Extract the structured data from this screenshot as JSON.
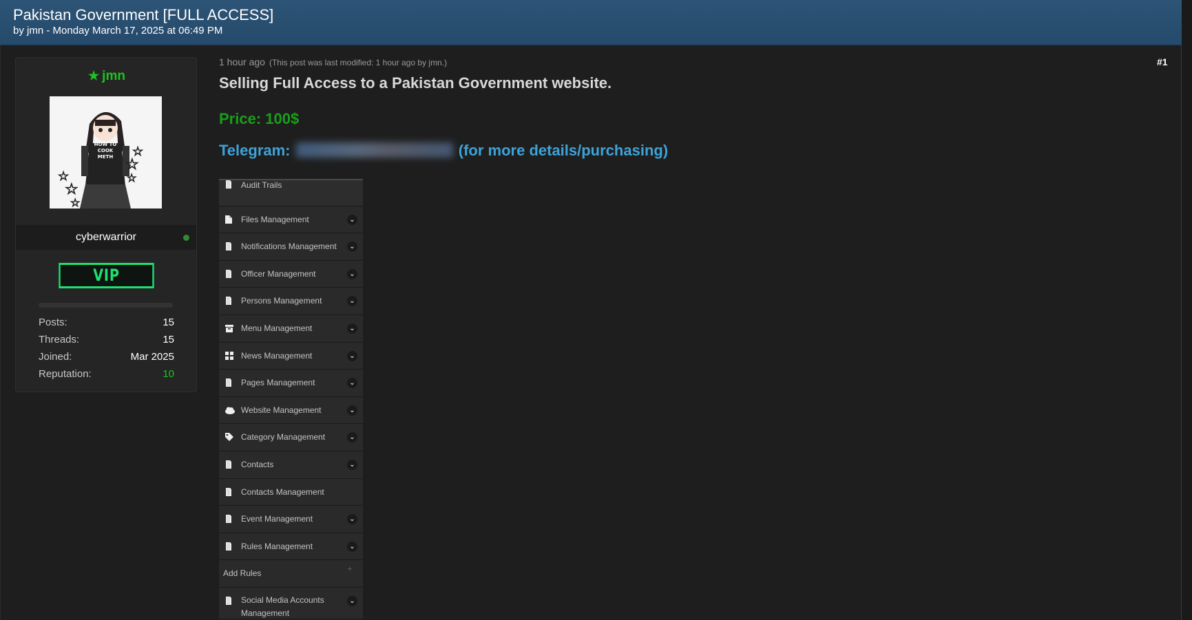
{
  "header": {
    "title": "Pakistan Government [FULL ACCESS]",
    "byline": "by jmn - Monday March 17, 2025 at 06:49 PM"
  },
  "user": {
    "name": "jmn",
    "usertitle": "cyberwarrior",
    "rank_badge": "VIP",
    "avatar_shirt_text": "HOW TO COOK METH",
    "stats": [
      {
        "label": "Posts:",
        "value": "15"
      },
      {
        "label": "Threads:",
        "value": "15"
      },
      {
        "label": "Joined:",
        "value": "Mar 2025"
      },
      {
        "label": "Reputation:",
        "value": "10"
      }
    ]
  },
  "post": {
    "time": "1 hour ago",
    "modified": "(This post was last modified: 1 hour ago by jmn.)",
    "number": "#1",
    "headline": "Selling Full Access to a Pakistan Government website.",
    "price": "Price: 100$",
    "telegram_label": "Telegram:",
    "telegram_suffix": "(for more details/purchasing)"
  },
  "screenshot_menu": [
    {
      "label": "Audit Trails",
      "icon": "doc-icon",
      "chevron": false
    },
    {
      "label": "Files Management",
      "icon": "file-icon",
      "chevron": true
    },
    {
      "label": "Notifications Management",
      "icon": "doc-icon",
      "chevron": true
    },
    {
      "label": "Officer Management",
      "icon": "doc-icon",
      "chevron": true
    },
    {
      "label": "Persons Management",
      "icon": "doc-icon",
      "chevron": true
    },
    {
      "label": "Menu Management",
      "icon": "archive-icon",
      "chevron": true
    },
    {
      "label": "News Management",
      "icon": "grid-icon",
      "chevron": true
    },
    {
      "label": "Pages Management",
      "icon": "doc-icon",
      "chevron": true
    },
    {
      "label": "Website Management",
      "icon": "cloud-icon",
      "chevron": true
    },
    {
      "label": "Category Management",
      "icon": "tag-icon",
      "chevron": true
    },
    {
      "label": "Contacts",
      "icon": "doc-icon",
      "chevron": true
    },
    {
      "label": "Contacts Management",
      "icon": "doc-icon",
      "chevron": false
    },
    {
      "label": "Event Management",
      "icon": "doc-icon",
      "chevron": true
    },
    {
      "label": "Rules Management",
      "icon": "doc-icon",
      "chevron": true
    },
    {
      "label": "Add Rules",
      "icon": "",
      "chevron": false
    },
    {
      "label": "Social Media Accounts Management",
      "icon": "doc-icon",
      "chevron": true
    }
  ],
  "colors": {
    "header_bg": "#2b5072",
    "username": "#1ec41e",
    "price": "#1a9e1a",
    "telegram": "#3da3d9",
    "vip": "#20e070"
  }
}
